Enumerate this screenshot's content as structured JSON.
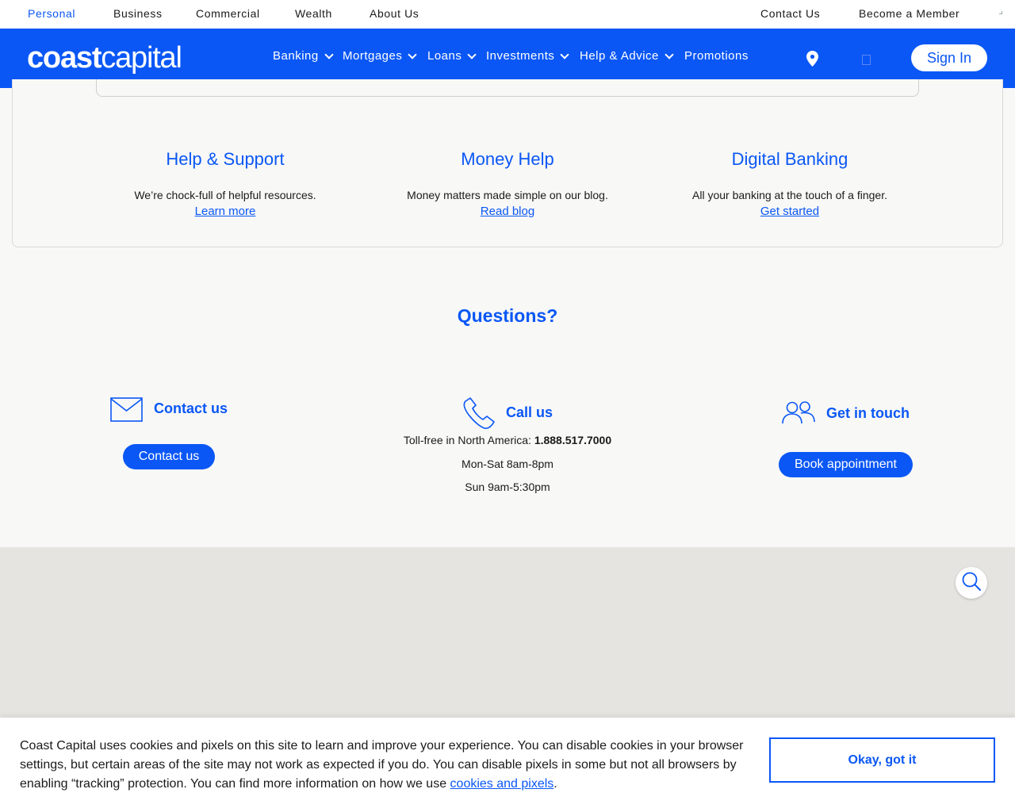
{
  "topbar": {
    "left": [
      "Personal",
      "Business",
      "Commercial",
      "Wealth",
      "About Us"
    ],
    "right": [
      "Contact Us",
      "Become a Member"
    ]
  },
  "logo": {
    "bold": "coast",
    "light": "capital"
  },
  "nav": {
    "items": [
      "Banking",
      "Mortgages",
      "Loans",
      "Investments",
      "Help & Advice",
      "Promotions"
    ],
    "sign_in": "Sign In"
  },
  "resources": [
    {
      "title": "Help & Support",
      "text": "We’re chock-full of helpful resources.",
      "link": "Learn more"
    },
    {
      "title": "Money Help",
      "text": "Money matters made simple on our blog.",
      "link": "Read blog"
    },
    {
      "title": "Digital Banking",
      "text": "All your banking at the touch of a finger.",
      "link": "Get started"
    }
  ],
  "questions": {
    "heading": "Questions?",
    "contact": {
      "title": "Contact us",
      "button": "Contact us"
    },
    "call": {
      "title": "Call us",
      "tollfree_label": "Toll-free in North America: ",
      "phone": "1.888.517.7000",
      "hours1": "Mon-Sat 8am-8pm",
      "hours2": "Sun 9am-5:30pm"
    },
    "touch": {
      "title": "Get in touch",
      "button": "Book appointment"
    }
  },
  "cookie": {
    "text": "Coast Capital uses cookies and pixels on this site to learn and improve your experience. You can disable cookies in your browser settings, but certain areas of the site may not work as expected if you do. You can disable pixels in some but not all browsers by enabling “tracking” protection. You can find more information on how we use ",
    "link": "cookies and pixels",
    "end": ".",
    "button": "Okay, got it"
  },
  "colors": {
    "brand": "#0a57f5",
    "map": "#e5e4e0",
    "page_bg": "#f8f8f7"
  }
}
